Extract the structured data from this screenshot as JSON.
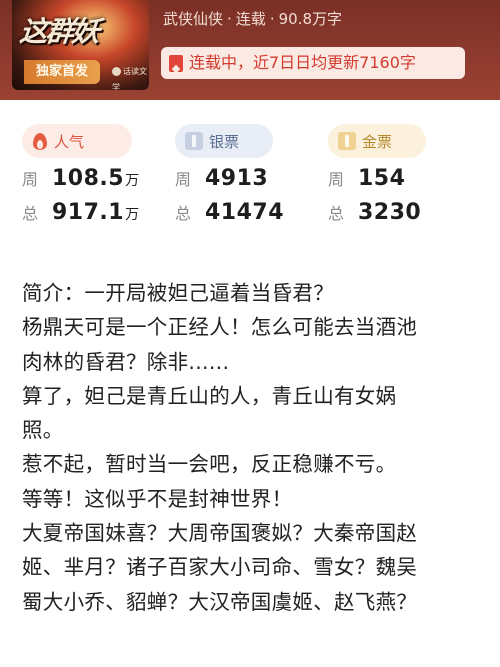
{
  "header": {
    "cover": {
      "title_art": "这群妖",
      "badge": "独家首发",
      "publisher": "话读文学"
    },
    "meta": {
      "genre": "武侠仙侠",
      "status": "连载",
      "word_count": "90.8万字",
      "separator": "·"
    },
    "update_notice": "连载中，近7日日均更新7160字"
  },
  "stats": {
    "popularity": {
      "label": "人气",
      "week_key": "周",
      "week_value": "108.5",
      "week_unit": "万",
      "total_key": "总",
      "total_value": "917.1",
      "total_unit": "万"
    },
    "silver": {
      "label": "银票",
      "week_key": "周",
      "week_value": "4913",
      "total_key": "总",
      "total_value": "41474"
    },
    "gold": {
      "label": "金票",
      "week_key": "周",
      "week_value": "154",
      "total_key": "总",
      "total_value": "3230"
    }
  },
  "intro": {
    "lines": [
      "简介：一开局被妲己逼着当昏君？",
      "杨鼎天可是一个正经人！怎么可能去当酒池",
      "肉林的昏君？除非......",
      "算了，妲己是青丘山的人，青丘山有女娲",
      "照。",
      "惹不起，暂时当一会吧，反正稳赚不亏。",
      "等等！这似乎不是封神世界！",
      "大夏帝国妹喜？大周帝国褒姒？大秦帝国赵",
      "姬、芈月？诸子百家大小司命、雪女？魏吴",
      "蜀大小乔、貂蝉？大汉帝国虞姬、赵飞燕？"
    ]
  },
  "colors": {
    "header_bg": "#8d3a2e",
    "accent_red": "#d43a2e",
    "popularity": "#d9553f",
    "silver": "#5b6f92",
    "gold": "#b8892f"
  }
}
